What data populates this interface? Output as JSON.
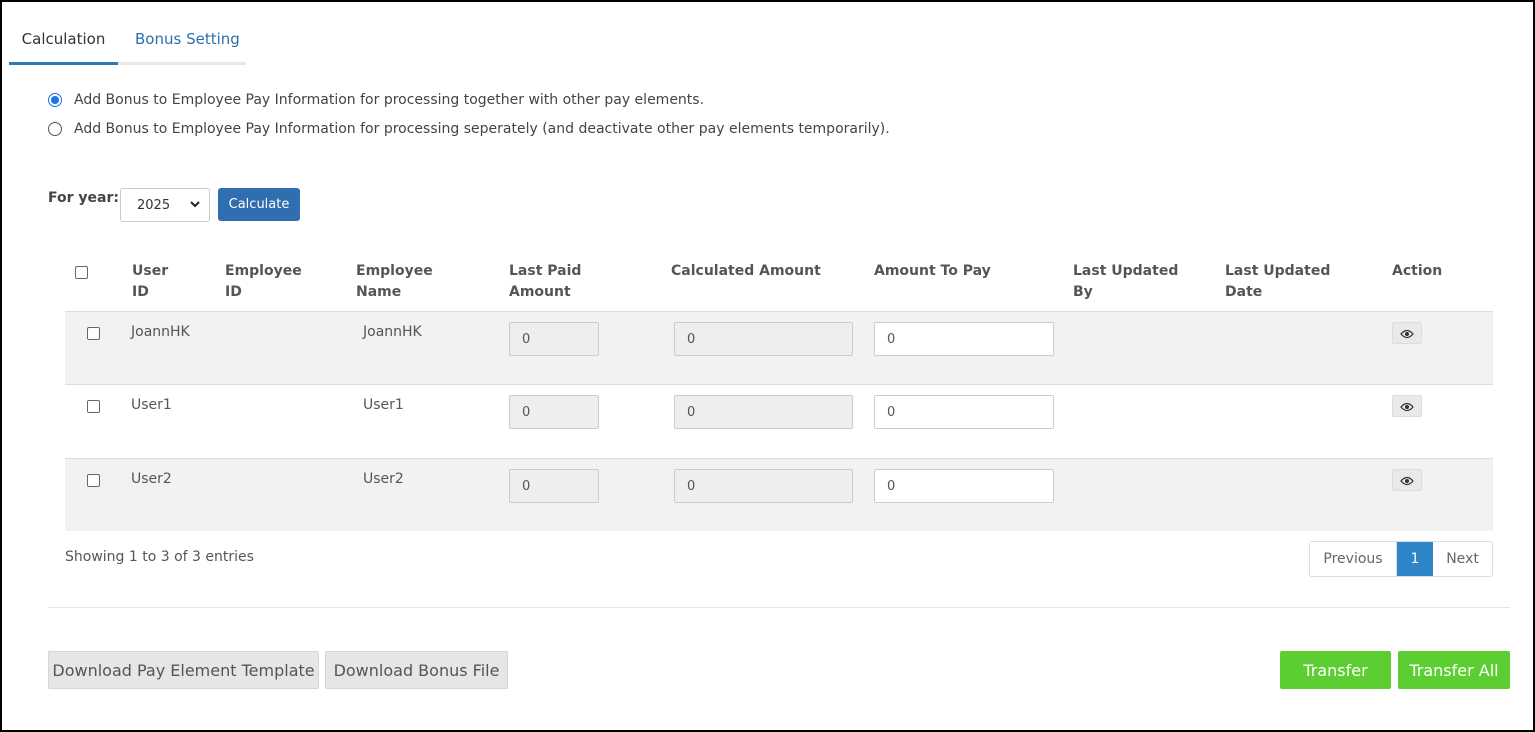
{
  "tabs": [
    {
      "label": "Calculation"
    },
    {
      "label": "Bonus Setting"
    }
  ],
  "options": [
    {
      "label": "Add Bonus to Employee Pay Information for processing together with other pay elements.",
      "checked": true
    },
    {
      "label": "Add Bonus to Employee Pay Information for processing seperately (and deactivate other pay elements temporarily).",
      "checked": false
    }
  ],
  "year": {
    "label": "For year:",
    "selected": "2025",
    "calculate_label": "Calculate"
  },
  "table": {
    "headers": {
      "user_id": [
        "User",
        "ID"
      ],
      "employee_id": [
        "Employee",
        "ID"
      ],
      "employee_name": [
        "Employee",
        "Name"
      ],
      "last_paid": [
        "Last Paid",
        "Amount"
      ],
      "calculated": "Calculated Amount",
      "amount_to_pay": "Amount To Pay",
      "updated_by": [
        "Last Updated",
        "By"
      ],
      "updated_date": [
        "Last Updated",
        "Date"
      ],
      "action": "Action"
    },
    "rows": [
      {
        "user_id": "JoannHK",
        "employee_id": "",
        "employee_name": "JoannHK",
        "last_paid": "0",
        "calculated": "0",
        "amount_to_pay": "0",
        "updated_by": "",
        "updated_date": ""
      },
      {
        "user_id": "User1",
        "employee_id": "",
        "employee_name": "User1",
        "last_paid": "0",
        "calculated": "0",
        "amount_to_pay": "0",
        "updated_by": "",
        "updated_date": ""
      },
      {
        "user_id": "User2",
        "employee_id": "",
        "employee_name": "User2",
        "last_paid": "0",
        "calculated": "0",
        "amount_to_pay": "0",
        "updated_by": "",
        "updated_date": ""
      }
    ]
  },
  "pagination": {
    "info": "Showing 1 to 3 of 3 entries",
    "previous": "Previous",
    "current": "1",
    "next": "Next"
  },
  "footer": {
    "download_template": "Download Pay Element Template",
    "download_bonus": "Download Bonus File",
    "transfer": "Transfer",
    "transfer_all": "Transfer All"
  },
  "colors": {
    "primary": "#2f6eb0",
    "success": "#5cce32",
    "page_active": "#2e86c9"
  }
}
